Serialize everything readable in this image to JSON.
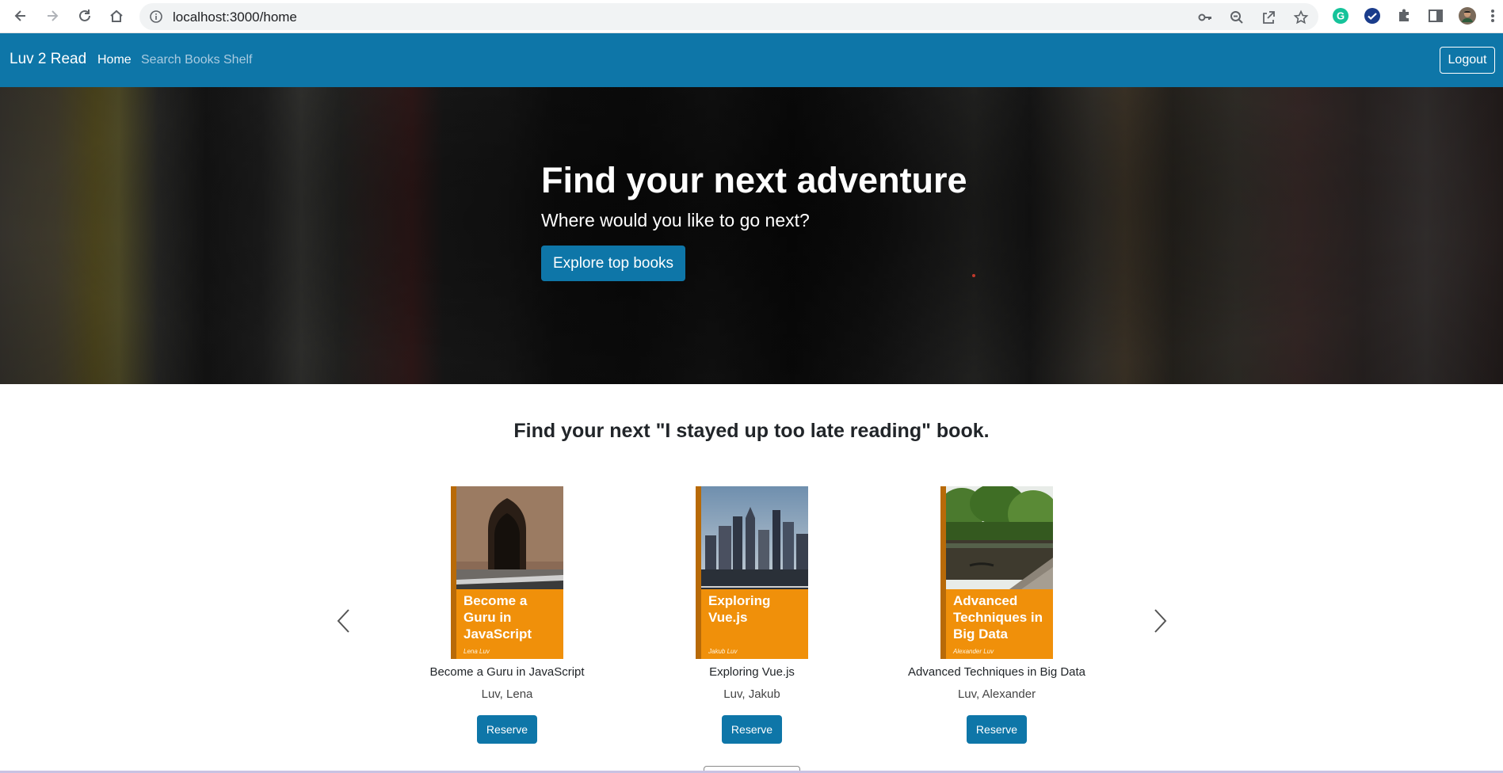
{
  "browser": {
    "url": "localhost:3000/home",
    "icons": [
      "back-icon",
      "forward-icon",
      "reload-icon",
      "home-icon",
      "info-icon",
      "key-icon",
      "zoom-out-icon",
      "share-icon",
      "star-icon",
      "grammarly-icon",
      "checkmark-extension-icon",
      "puzzle-icon",
      "sidebar-icon",
      "profile-avatar",
      "more-icon"
    ]
  },
  "navbar": {
    "brand": "Luv 2 Read",
    "links": [
      "Home",
      "Search Books",
      "Shelf"
    ],
    "active": "Home",
    "logout_label": "Logout",
    "color": "#0e76a8"
  },
  "hero": {
    "title": "Find your next adventure",
    "subtitle": "Where would you like to go next?",
    "button_label": "Explore top books"
  },
  "main": {
    "section_title": "Find your next \"I stayed up too late reading\" book.",
    "books": [
      {
        "cover_title": "Become a Guru in JavaScript",
        "cover_author": "Lena Luv",
        "title": "Become a Guru in JavaScript",
        "author": "Luv, Lena",
        "button": "Reserve"
      },
      {
        "cover_title": "Exploring Vue.js",
        "cover_author": "Jakub Luv",
        "title": "Exploring Vue.js",
        "author": "Luv, Jakub",
        "button": "Reserve"
      },
      {
        "cover_title": "Advanced Techniques in Big Data",
        "cover_author": "Alexander Luv",
        "title": "Advanced Techniques in Big Data",
        "author": "Luv, Alexander",
        "button": "Reserve"
      }
    ]
  }
}
